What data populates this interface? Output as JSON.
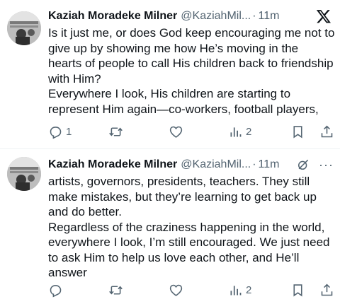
{
  "colors": {
    "text": "#0f1419",
    "secondary": "#536471",
    "divider": "#eff3f4"
  },
  "tweets": [
    {
      "author": "Kaziah Moradeke Milner",
      "handle": "@KaziahMil...",
      "dot": "·",
      "time": "11m",
      "header_icon": "x-logo-icon",
      "paragraphs": [
        "Is it just me, or does God keep encouraging me not to give up by showing me how He’s moving in the hearts of people to call His children back to friendship with Him?",
        "Everywhere I look, His children are starting to represent Him again—co-workers, football players,"
      ],
      "reply_count": "1",
      "repost_count": "",
      "like_count": "",
      "view_count": "2"
    },
    {
      "author": "Kaziah Moradeke Milner",
      "handle": "@KaziahMil...",
      "dot": "·",
      "time": "11m",
      "header_icon": "grok-icon",
      "more": "···",
      "paragraphs": [
        "artists, governors, presidents, teachers. They still make mistakes, but they’re learning to get back up and do better.",
        "Regardless of the craziness happening in the world, everywhere I look, I’m still encouraged. We just need to ask Him to help us love each other, and He’ll answer"
      ],
      "reply_count": "",
      "repost_count": "",
      "like_count": "",
      "view_count": "2"
    }
  ]
}
